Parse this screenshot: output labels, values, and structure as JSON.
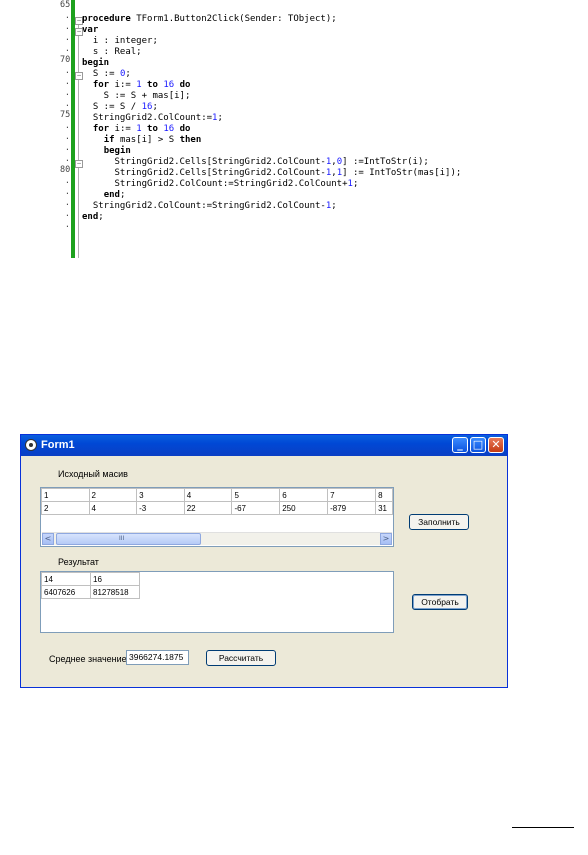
{
  "editor": {
    "line_numbers": [
      "65",
      ".",
      ".",
      ".",
      ".",
      "70",
      ".",
      ".",
      ".",
      ".",
      "75",
      ".",
      ".",
      ".",
      ".",
      "80",
      ".",
      ".",
      ".",
      ".",
      "."
    ],
    "lines": [
      "",
      "procedure TForm1.Button2Click(Sender: TObject);",
      "var",
      "  i : integer;",
      "  s : Real;",
      "begin",
      "  S := 0;",
      "  for i:= 1 to 16 do",
      "    S := S + mas[i];",
      "  S := S / 16;",
      "  StringGrid2.ColCount:=1;",
      "  for i:= 1 to 16 do",
      "    if mas[i] > S then",
      "    begin",
      "      StringGrid2.Cells[StringGrid2.ColCount-1,0] :=IntToStr(i);",
      "      StringGrid2.Cells[StringGrid2.ColCount-1,1] := IntToStr(mas[i]);",
      "      StringGrid2.ColCount:=StringGrid2.ColCount+1;",
      "    end;",
      "  StringGrid2.ColCount:=StringGrid2.ColCount-1;",
      "end;"
    ]
  },
  "window": {
    "title": "Form1",
    "minimize": "_",
    "maximize": "□",
    "close": "✕"
  },
  "source_label": "Исходный масив",
  "source_grid": {
    "rows": [
      [
        "1",
        "2",
        "3",
        "4",
        "5",
        "6",
        "7",
        "8"
      ],
      [
        "2",
        "4",
        "-3",
        "22",
        "-67",
        "250",
        "-879",
        "31"
      ]
    ]
  },
  "scroll": {
    "left": "<",
    "right": ">",
    "thumb": "III"
  },
  "result_label": "Результат",
  "result_grid": {
    "rows": [
      [
        "14",
        "16"
      ],
      [
        "6407626",
        "81278518"
      ]
    ]
  },
  "buttons": {
    "fill": "Заполнить",
    "select": "Отобрать",
    "calculate": "Рассчитать"
  },
  "average": {
    "label": "Среднее значение",
    "value": "3966274.1875"
  },
  "colors": {
    "titlebar": "#0a5fde",
    "form_bg": "#ece9d8",
    "editor_gutter": "#1da11d"
  }
}
